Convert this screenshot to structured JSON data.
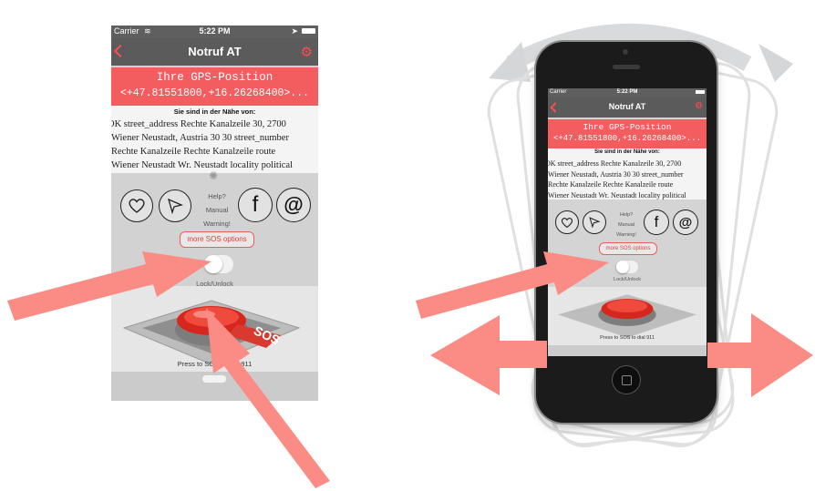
{
  "status": {
    "carrier": "Carrier",
    "time": "5:22 PM"
  },
  "nav": {
    "title": "Notruf AT"
  },
  "gps": {
    "title": "Ihre GPS-Position",
    "coords": "<+47.81551800,+16.26268400>..."
  },
  "nearby": {
    "header": "Sie sind in der Nähe von:",
    "lines": [
      "OK street_address Rechte Kanalzeile 30, 2700",
      "Wiener Neustadt, Austria 30 30 street_number",
      "Rechte Kanalzeile Rechte Kanalzeile route",
      "Wiener Neustadt Wr. Neustadt locality political"
    ]
  },
  "options": {
    "help": "Help?",
    "manual": "Manual",
    "warning": "Warning!",
    "facebook": "f",
    "email": "@"
  },
  "more_sos": "more SOS options",
  "lock_label": "Lock/Unlock",
  "sos_button": {
    "label": "SOS",
    "caption": "Press to SOS to dial 911"
  },
  "icons": [
    "back-chevron-icon",
    "gear-icon",
    "heart-icon",
    "paper-plane-icon",
    "facebook-icon",
    "at-sign-icon",
    "activity-spinner-icon",
    "sos-button-icon",
    "home-button-icon"
  ],
  "colors": {
    "accent_red": "#f45d5f",
    "nav_gray": "#5b5b5b",
    "arrow_salmon": "#fb8c85",
    "background": "#ffffff"
  }
}
